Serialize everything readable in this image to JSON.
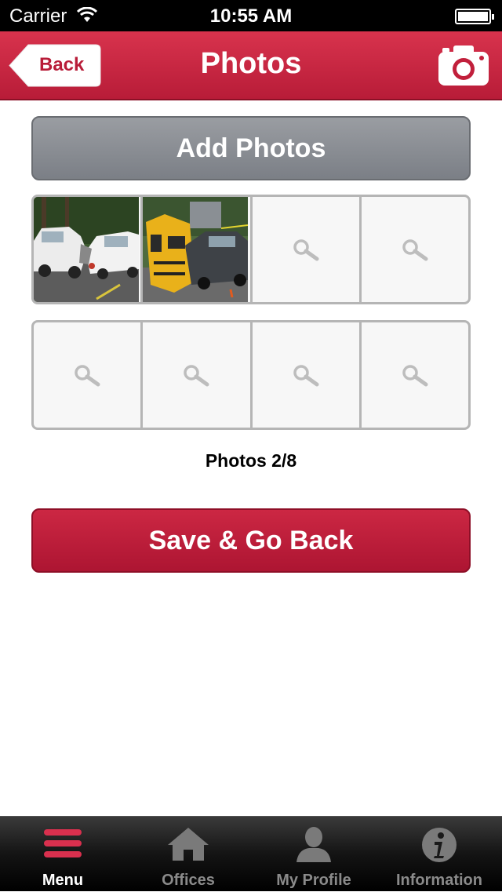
{
  "status_bar": {
    "carrier": "Carrier",
    "time": "10:55 AM"
  },
  "nav": {
    "title": "Photos",
    "back_label": "Back"
  },
  "add_photos_label": "Add Photos",
  "photos": {
    "count_text": "Photos 2/8",
    "slots": [
      {
        "filled": true
      },
      {
        "filled": true
      },
      {
        "filled": false
      },
      {
        "filled": false
      },
      {
        "filled": false
      },
      {
        "filled": false
      },
      {
        "filled": false
      },
      {
        "filled": false
      }
    ]
  },
  "save_label": "Save & Go Back",
  "tabs": [
    {
      "label": "Menu",
      "icon": "menu-icon",
      "active": true
    },
    {
      "label": "Offices",
      "icon": "home-icon",
      "active": false
    },
    {
      "label": "My Profile",
      "icon": "person-icon",
      "active": false
    },
    {
      "label": "Information",
      "icon": "info-icon",
      "active": false
    }
  ],
  "colors": {
    "accent": "#b81c38",
    "gray_button": "#8a8d92"
  }
}
